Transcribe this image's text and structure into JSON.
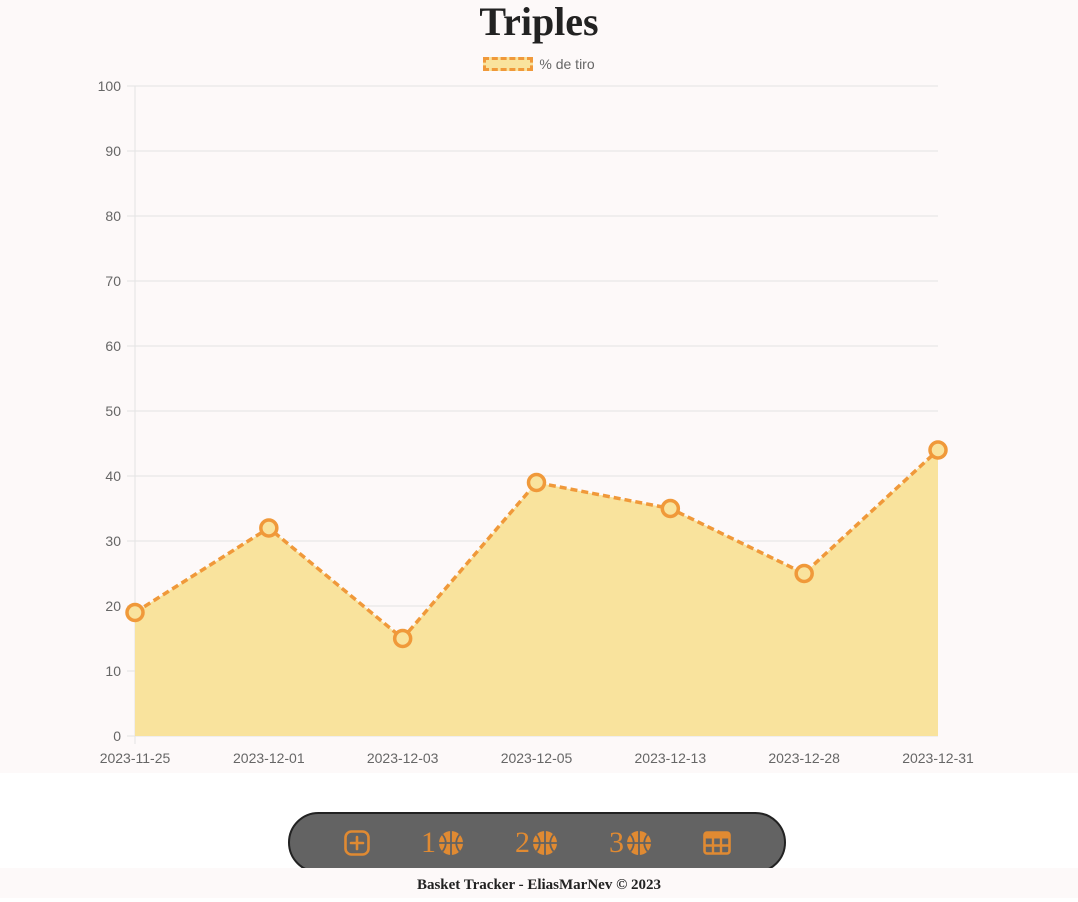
{
  "page": {
    "title": "Triples",
    "footer": "Basket Tracker - EliasMarNev © 2023"
  },
  "nav": {
    "items": [
      {
        "icon": "add-square-icon",
        "label": ""
      },
      {
        "icon": "basketball-icon",
        "label": "1"
      },
      {
        "icon": "basketball-icon",
        "label": "2"
      },
      {
        "icon": "basketball-icon",
        "label": "3"
      },
      {
        "icon": "table-grid-icon",
        "label": ""
      }
    ],
    "accent_color": "#e08a32",
    "background_color": "#636363"
  },
  "chart_data": {
    "type": "area",
    "title": "Triples",
    "categories": [
      "2023-11-25",
      "2023-12-01",
      "2023-12-03",
      "2023-12-05",
      "2023-12-13",
      "2023-12-28",
      "2023-12-31"
    ],
    "series": [
      {
        "name": "% de tiro",
        "values": [
          19,
          32,
          15,
          39,
          35,
          25,
          44
        ],
        "line_color": "#f0993a",
        "fill_color": "#f9e39d",
        "line_style": "dashed"
      }
    ],
    "ylim": [
      0,
      100
    ],
    "yticks": [
      0,
      10,
      20,
      30,
      40,
      50,
      60,
      70,
      80,
      90,
      100
    ],
    "grid": true,
    "legend_position": "top-center"
  }
}
